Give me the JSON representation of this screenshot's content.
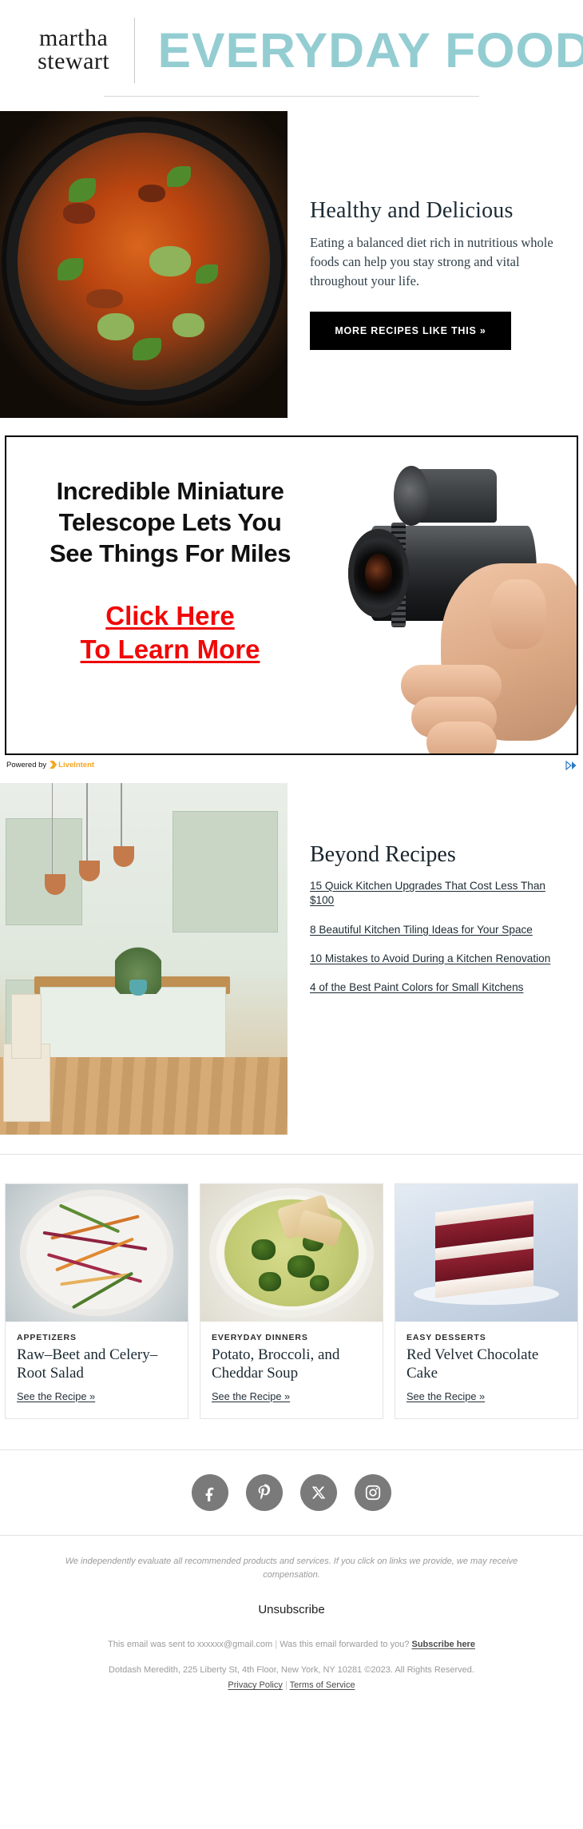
{
  "header": {
    "brand_line1": "martha",
    "brand_line2": "stewart",
    "title": "EVERYDAY FOOD",
    "accent_color": "#93cdd2"
  },
  "hero": {
    "image_alt": "skillet-of-chili-with-avocado-and-cilantro",
    "title": "Healthy and Delicious",
    "body": "Eating a balanced diet rich in nutritious whole foods can help you stay strong and vital throughout your life.",
    "cta_label": "MORE RECIPES LIKE THIS »"
  },
  "ad": {
    "headline_line1": "Incredible Miniature",
    "headline_line2": "Telescope Lets You",
    "headline_line3": "See Things For Miles",
    "cta_line1": "Click Here",
    "cta_line2": "To Learn More",
    "cta_color": "#f00808",
    "image_alt": "hand-holding-black-monocular-telescope",
    "powered_by_label": "Powered by",
    "network_name": "LiveIntent",
    "network_color": "#f5a623",
    "adchoices_label": "AdChoices"
  },
  "beyond": {
    "image_alt": "sage-green-kitchen-with-copper-pendant-lights",
    "title": "Beyond Recipes",
    "links": [
      "15 Quick Kitchen Upgrades That Cost Less Than $100",
      "8 Beautiful Kitchen Tiling Ideas for Your Space",
      "10 Mistakes to Avoid During a Kitchen Renovation",
      "4 of the Best Paint Colors for Small Kitchens"
    ]
  },
  "cards": [
    {
      "image_alt": "raw-beet-and-celery-root-salad-on-white-plate",
      "kicker": "APPETIZERS",
      "title": "Raw–Beet and Celery–Root Salad",
      "link_label": "See the Recipe »"
    },
    {
      "image_alt": "potato-broccoli-cheddar-soup-with-bread",
      "kicker": "EVERYDAY DINNERS",
      "title": "Potato, Broccoli, and Cheddar Soup",
      "link_label": "See the Recipe »"
    },
    {
      "image_alt": "slice-of-red-velvet-chocolate-cake",
      "kicker": "EASY DESSERTS",
      "title": "Red Velvet Chocolate Cake",
      "link_label": "See the Recipe »"
    }
  ],
  "social": [
    {
      "name": "facebook",
      "label": "Facebook"
    },
    {
      "name": "pinterest",
      "label": "Pinterest"
    },
    {
      "name": "x-twitter",
      "label": "X"
    },
    {
      "name": "instagram",
      "label": "Instagram"
    }
  ],
  "footer": {
    "disclaimer": "We independently evaluate all recommended products and services. If you click on links we provide, we may receive compensation.",
    "unsubscribe_label": "Unsubscribe",
    "sent_to_prefix": "This email was sent to",
    "recipient_email": "xxxxxx@gmail.com",
    "pipe": "|",
    "forwarded_question": "Was this email forwarded to you?",
    "subscribe_label": "Subscribe here",
    "address": "Dotdash Meredith, 225 Liberty St, 4th Floor, New York, NY 10281 ©2023. All Rights Reserved.",
    "privacy_label": "Privacy Policy",
    "terms_label": "Terms of Service"
  }
}
